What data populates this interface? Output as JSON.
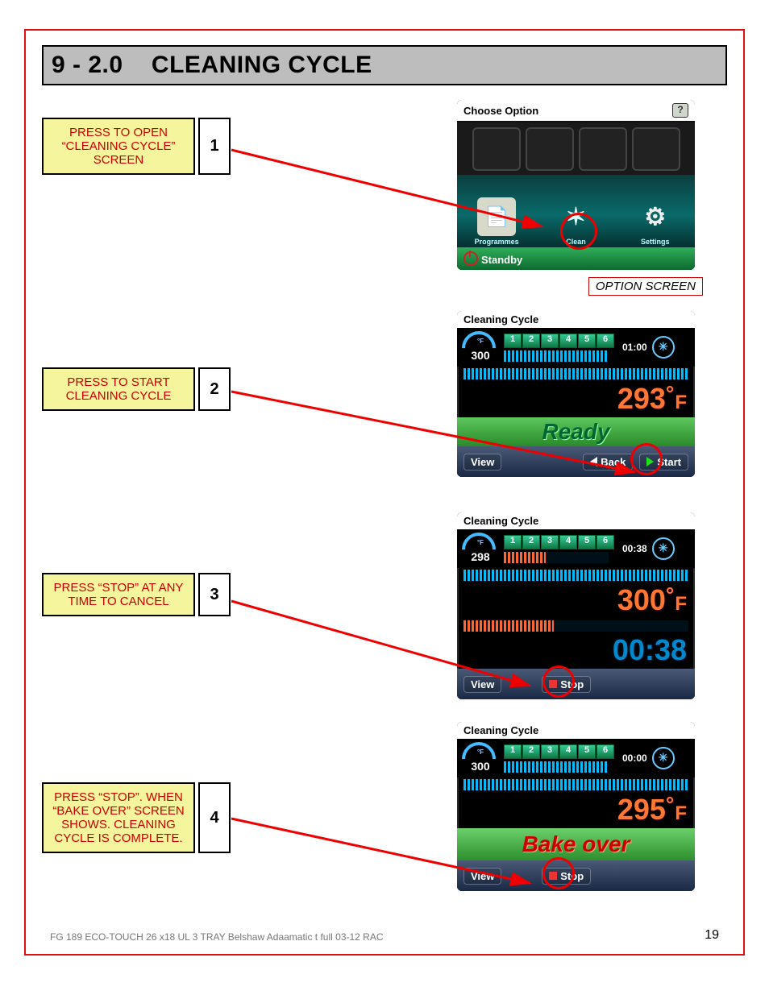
{
  "section_number": "9 - 2.0",
  "section_title": "CLEANING CYCLE",
  "callouts": [
    {
      "num": "1",
      "text": "PRESS TO OPEN “CLEANING CYCLE” SCREEN"
    },
    {
      "num": "2",
      "text": "PRESS TO START CLEANING CYCLE"
    },
    {
      "num": "3",
      "text": "PRESS “STOP” AT ANY TIME TO CANCEL"
    },
    {
      "num": "4",
      "text": "PRESS “STOP”. WHEN “BAKE OVER” SCREEN SHOWS. CLEANING CYCLE IS COMPLETE."
    }
  ],
  "option_screen_caption": "OPTION SCREEN",
  "screen1": {
    "title": "Choose Option",
    "icon_programmes": "Programmes",
    "icon_clean": "Clean",
    "icon_settings": "Settings",
    "standby": "Standby"
  },
  "screen2": {
    "title": "Cleaning Cycle",
    "gauge_unit": "°F",
    "gauge_val": "300",
    "stages": [
      "1",
      "2",
      "3",
      "4",
      "5",
      "6"
    ],
    "mini_time": "01:00",
    "temp_val": "293",
    "temp_deg": "°",
    "temp_unit": "F",
    "state": "Ready",
    "btn_view": "View",
    "btn_back": "Back",
    "btn_start": "Start"
  },
  "screen3": {
    "title": "Cleaning Cycle",
    "gauge_unit": "°F",
    "gauge_val": "298",
    "stages": [
      "1",
      "2",
      "3",
      "4",
      "5",
      "6"
    ],
    "mini_time": "00:38",
    "temp_val": "300",
    "temp_deg": "°",
    "temp_unit": "F",
    "timer": "00:38",
    "btn_view": "View",
    "btn_stop": "Stop"
  },
  "screen4": {
    "title": "Cleaning Cycle",
    "gauge_unit": "°F",
    "gauge_val": "300",
    "stages": [
      "1",
      "2",
      "3",
      "4",
      "5",
      "6"
    ],
    "mini_time": "00:00",
    "temp_val": "295",
    "temp_deg": "°",
    "temp_unit": "F",
    "state": "Bake over",
    "btn_view": "View",
    "btn_stop": "Stop"
  },
  "footer_text": "FG 189 ECO-TOUCH 26 x18 UL 3 TRAY Belshaw Adaamatic t full 03-12 RAC",
  "page_number": "19"
}
